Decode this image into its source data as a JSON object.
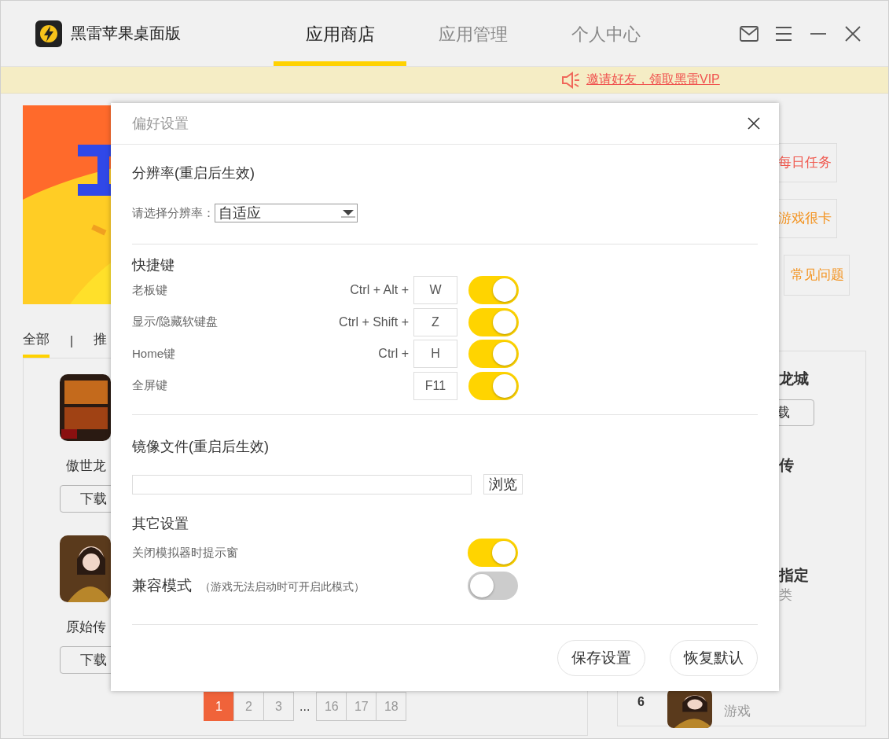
{
  "window": {
    "title": "黑雷苹果桌面版"
  },
  "nav_tabs": [
    {
      "label": "应用商店",
      "selected": true
    },
    {
      "label": "应用管理",
      "selected": false
    },
    {
      "label": "个人中心",
      "selected": false
    }
  ],
  "notice": {
    "text": "邀请好友，领取黑雷VIP"
  },
  "category_tabs": [
    {
      "label": "全部",
      "selected": true
    },
    {
      "label": "推",
      "selected": false
    }
  ],
  "category_separator": "|",
  "apps": [
    {
      "name": "傲世龙",
      "button": "下载"
    },
    {
      "name": "原始传",
      "button": "下载"
    }
  ],
  "pagination": {
    "pages": [
      {
        "kind": "page",
        "label": "1",
        "selected": true
      },
      {
        "kind": "page",
        "label": "2",
        "selected": false
      },
      {
        "kind": "page",
        "label": "3",
        "selected": false
      },
      {
        "kind": "ellipsis",
        "label": "..."
      },
      {
        "kind": "page",
        "label": "16",
        "selected": false
      },
      {
        "kind": "page",
        "label": "17",
        "selected": false
      },
      {
        "kind": "page",
        "label": "18",
        "selected": false
      }
    ]
  },
  "help_buttons": [
    {
      "label": "每日任务",
      "color": "#f0584e"
    },
    {
      "label": "游戏很卡",
      "color": "#f39422"
    },
    {
      "label": "常见问题",
      "color": "#f39422"
    }
  ],
  "ranking": [
    {
      "title": "龙城",
      "button": "载"
    },
    {
      "title": "传"
    },
    {
      "title": "指定",
      "subtitle": "类"
    },
    {
      "rank": "6",
      "subtitle": "游戏"
    }
  ],
  "dialog": {
    "title": "偏好设置",
    "resolution": {
      "heading": "分辨率(重启后生效)",
      "label": "请选择分辨率：",
      "value": "自适应"
    },
    "shortcuts": {
      "heading": "快捷键",
      "items": [
        {
          "label": "老板键",
          "combo": "Ctrl + Alt +",
          "key": "W",
          "on": true
        },
        {
          "label": "显示/隐藏软键盘",
          "combo": "Ctrl + Shift +",
          "key": "Z",
          "on": true
        },
        {
          "label": "Home键",
          "combo": "Ctrl +",
          "key": "H",
          "on": true
        },
        {
          "label": "全屏键",
          "key": "F11",
          "on": true
        }
      ]
    },
    "image_file": {
      "heading": "镜像文件(重启后生效)",
      "button": "浏览"
    },
    "other": {
      "heading": "其它设置",
      "items": [
        {
          "label": "关闭模拟器时提示窗",
          "on": true
        },
        {
          "label": "兼容模式",
          "note": "（游戏无法启动时可开启此模式）",
          "on": false
        }
      ]
    },
    "buttons": [
      "保存设置",
      "恢复默认"
    ]
  }
}
